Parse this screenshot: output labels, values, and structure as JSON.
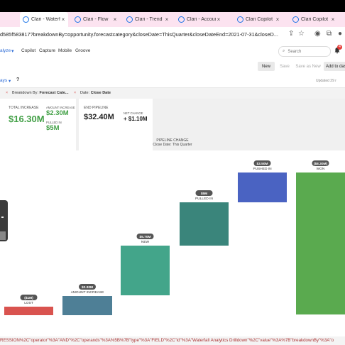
{
  "tabs": [
    {
      "label": "Clari - Waterfall",
      "active": true
    },
    {
      "label": "Clari - Flow",
      "active": false
    },
    {
      "label": "Clari - Trend",
      "active": false
    },
    {
      "label": "Clari - Account",
      "active": false
    },
    {
      "label": "Clari Copilot",
      "active": false
    },
    {
      "label": "Clari Copilot",
      "active": false
    }
  ],
  "address": {
    "url": "d585f583817?breakdownBy=opportunity.forecastcategory&closeDate=ThisQuarter&closeDateEnd=2021-07-31&closeD..."
  },
  "nav": {
    "items": [
      "alyze",
      "Copilot",
      "Capture",
      "Mobile",
      "Groove"
    ],
    "search_placeholder": "Search",
    "badge_count": "4"
  },
  "toolbar": {
    "new_label": "New",
    "save_label": "Save",
    "save_as_new_label": "Save as New",
    "add_label": "Add to das"
  },
  "filters": {
    "days_label": "ays",
    "help": "?",
    "updated": "Updated 29 r",
    "chip_breakdown_label": "Breakdown By:",
    "chip_breakdown_value": "Forecast Cate...",
    "chip_date_label": "Date:",
    "chip_date_value": "Close Date"
  },
  "kpis": {
    "total_increase_label": "TOTAL INCREASE",
    "total_increase_value": "$16.30M",
    "amount_increase_label": "AMOUNT INCREASE",
    "amount_increase_value": "$2.30M",
    "pulled_in_label": "PULLED IN",
    "pulled_in_value": "$5M",
    "end_pipeline_label": "END PIPELINE",
    "end_pipeline_value": "$32.40M",
    "net_change_label": "NET CHANGE",
    "net_change_value": "+ $1.10M"
  },
  "chart_data": {
    "type": "bar",
    "title": "PIPELINE CHANGE",
    "subtitle": "Close Date: This Quarter",
    "categories": [
      "LOST",
      "AMOUNT INCREASE",
      "NEW",
      "PULLED IN",
      "PUSHED IN",
      "WON"
    ],
    "value_labels": [
      "($1M)",
      "$2.30M",
      "$5.70M",
      "$5M",
      "$3.50M",
      "($8.30M)"
    ],
    "colors": {
      "lost": "#d9534f",
      "amount_increase": "#4e7f96",
      "new": "#43a58a",
      "pulled_in": "#3a857b",
      "pushed_in": "#4a63c2",
      "won": "#5aaa4f"
    }
  },
  "status_url": "RESSION%2C\"operator\"%3A\"AND\"%2C\"operands\"%3A%5B%7B\"type\"%3A\"FIELD\"%2C\"id\"%3A\"Waterfall Analytics Drilldown\"%2C\"value\"%3A%7B\"breakdownBy\"%3A\"o"
}
